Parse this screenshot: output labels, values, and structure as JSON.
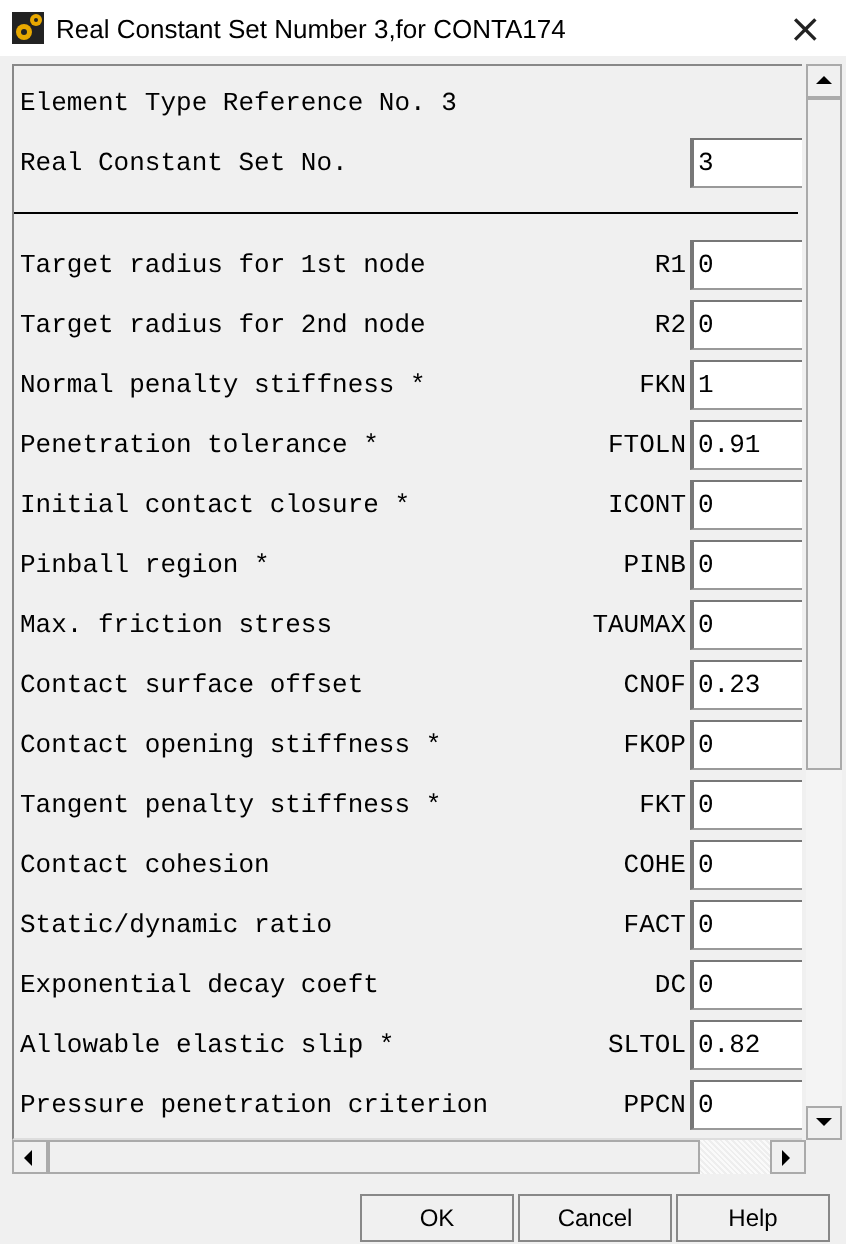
{
  "window": {
    "title": "Real Constant Set Number 3,for CONTA174",
    "close": "×"
  },
  "header": {
    "element_type": "Element Type Reference No. 3",
    "set_label": "Real Constant Set No.",
    "set_value": "3"
  },
  "constants": [
    {
      "label": "Target radius for 1st node",
      "code": "R1",
      "value": "0"
    },
    {
      "label": "Target radius for 2nd node",
      "code": "R2",
      "value": "0"
    },
    {
      "label": "Normal penalty stiffness *",
      "code": "FKN",
      "value": "1"
    },
    {
      "label": "Penetration tolerance *",
      "code": "FTOLN",
      "value": "0.91"
    },
    {
      "label": "Initial contact closure *",
      "code": "ICONT",
      "value": "0"
    },
    {
      "label": "Pinball region *",
      "code": "PINB",
      "value": "0"
    },
    {
      "label": "Max. friction stress",
      "code": "TAUMAX",
      "value": "0"
    },
    {
      "label": "Contact surface offset",
      "code": "CNOF",
      "value": "0.23"
    },
    {
      "label": "Contact opening stiffness *",
      "code": "FKOP",
      "value": "0"
    },
    {
      "label": "Tangent penalty stiffness *",
      "code": "FKT",
      "value": "0"
    },
    {
      "label": "Contact cohesion",
      "code": "COHE",
      "value": "0"
    },
    {
      "label": "Static/dynamic ratio",
      "code": "FACT",
      "value": "0"
    },
    {
      "label": "Exponential decay coeft",
      "code": "DC",
      "value": "0"
    },
    {
      "label": "Allowable elastic slip *",
      "code": "SLTOL",
      "value": "0.82"
    },
    {
      "label": "Pressure penetration criterion",
      "code": "PPCN",
      "value": "0"
    }
  ],
  "buttons": [
    "OK",
    "Cancel",
    "Help"
  ]
}
